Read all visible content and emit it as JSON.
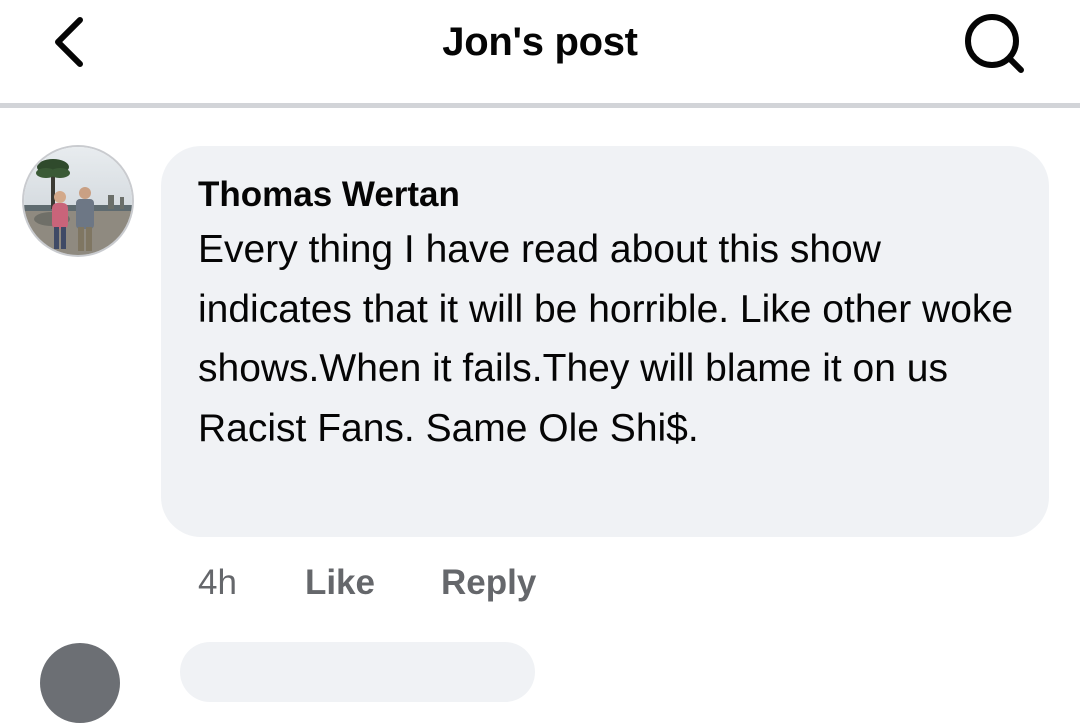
{
  "header": {
    "title": "Jon's post",
    "back_icon": "chevron-left-icon",
    "search_icon": "search-icon"
  },
  "comment": {
    "author": "Thomas Wertan",
    "text": "Every thing I have read about this show indicates that it will be horrible. Like other woke shows.When it fails.They will blame it on us Racist Fans. Same Ole Shi$.",
    "time": "4h",
    "like_label": "Like",
    "reply_label": "Reply"
  },
  "colors": {
    "bubble_background": "#f0f2f5",
    "secondary_text": "#65676b",
    "primary_text": "#050505",
    "divider": "#d2d4d8"
  }
}
